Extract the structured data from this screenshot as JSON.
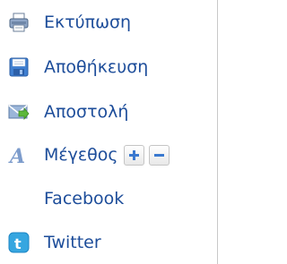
{
  "tools": {
    "print": {
      "label": "Εκτύπωση",
      "icon": "printer-icon"
    },
    "save": {
      "label": "Αποθήκευση",
      "icon": "floppy-disk-icon"
    },
    "send": {
      "label": "Αποστολή",
      "icon": "envelope-send-icon"
    },
    "font_size": {
      "label": "Μέγεθος",
      "icon": "font-size-icon",
      "increase_icon": "plus-icon",
      "decrease_icon": "minus-icon"
    },
    "facebook": {
      "label": "Facebook"
    },
    "twitter": {
      "label": "Twitter",
      "icon": "twitter-icon"
    }
  },
  "colors": {
    "link": "#1d4d9a",
    "button_icon": "#3a79d0"
  }
}
